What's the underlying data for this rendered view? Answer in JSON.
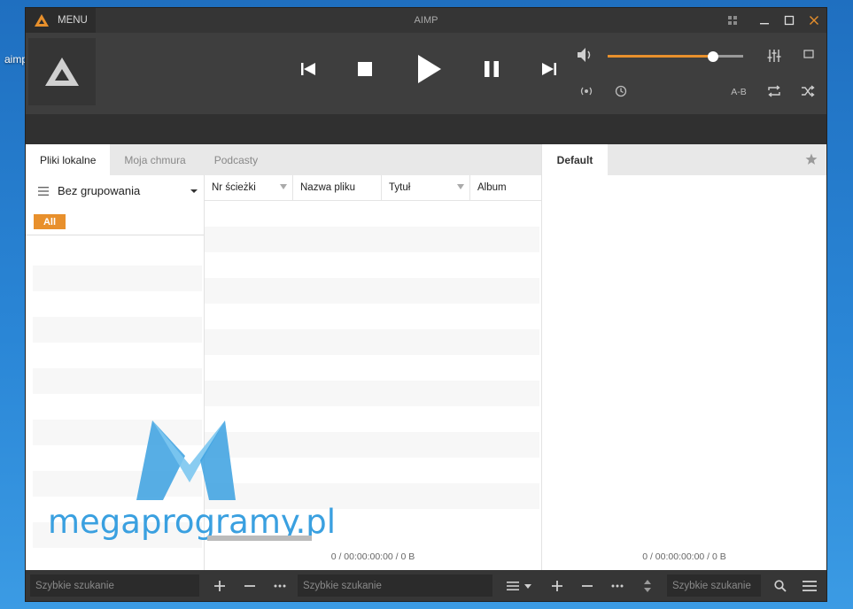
{
  "desktop": {
    "label": "aimp",
    "os_number": "7"
  },
  "titlebar": {
    "menu_label": "MENU",
    "title": "AIMP"
  },
  "player": {
    "volume_level": 0.78,
    "ab_label": "A-B"
  },
  "tabs": [
    {
      "label": "Pliki lokalne",
      "active": true
    },
    {
      "label": "Moja chmura",
      "active": false
    },
    {
      "label": "Podcasty",
      "active": false
    }
  ],
  "playlist": {
    "tab_label": "Default",
    "status": "0 / 00:00:00:00 / 0 B"
  },
  "groups": {
    "title": "Bez grupowania",
    "all_label": "All"
  },
  "columns": [
    {
      "label": "Nr ścieżki",
      "filter": true
    },
    {
      "label": "Nazwa pliku",
      "filter": false
    },
    {
      "label": "Tytuł",
      "filter": true
    },
    {
      "label": "Album",
      "filter": false
    }
  ],
  "library": {
    "status": "0 / 00:00:00:00 / 0 B"
  },
  "bottombar": {
    "search1_placeholder": "Szybkie szukanie",
    "search2_placeholder": "Szybkie szukanie",
    "search3_placeholder": "Szybkie szukanie"
  },
  "watermark": {
    "text": "megaprogramy.pl"
  },
  "colors": {
    "accent": "#e8902c",
    "watermark": "#3aa0e0"
  }
}
